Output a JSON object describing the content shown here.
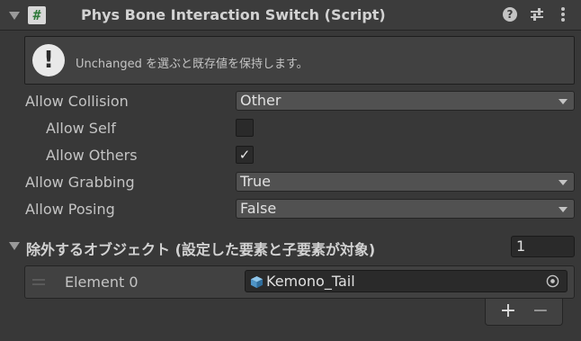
{
  "component": {
    "title": "Phys Bone Interaction Switch (Script)",
    "script_icon_glyph": "#",
    "header_icons": [
      "help-icon",
      "preset-icon",
      "menu-icon"
    ]
  },
  "infobox": {
    "icon_glyph": "!",
    "text": "Unchanged を選ぶと既存値を保持します。"
  },
  "fields": {
    "allow_collision": {
      "label": "Allow Collision",
      "value": "Other"
    },
    "allow_self": {
      "label": "Allow Self",
      "checked": false
    },
    "allow_others": {
      "label": "Allow Others",
      "checked": true,
      "check_glyph": "✓"
    },
    "allow_grabbing": {
      "label": "Allow Grabbing",
      "value": "True"
    },
    "allow_posing": {
      "label": "Allow Posing",
      "value": "False"
    }
  },
  "exclusions": {
    "label": "除外するオブジェクト (設定した要素と子要素が対象)",
    "size": "1",
    "elements": [
      {
        "label": "Element 0",
        "value": "Kemono_Tail"
      }
    ],
    "add_glyph": "+",
    "remove_glyph": "−"
  },
  "colors": {
    "background": "#383838",
    "header": "#3c3c3c",
    "field": "#515151",
    "input": "#2a2a2a",
    "text": "#c4c4c4"
  }
}
